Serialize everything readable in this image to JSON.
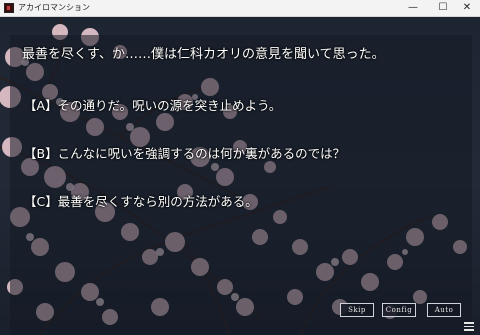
{
  "window": {
    "title": "アカイロマンション",
    "minimize_glyph": "—",
    "maximize_glyph": "☐",
    "close_glyph": "✕"
  },
  "dialogue": {
    "narration": "最善を尽くす、か……僕は仁科カオリの意見を聞いて思った。"
  },
  "choices": [
    {
      "label": "【A】その通りだ。呪いの源を突き止めよう。"
    },
    {
      "label": "【B】こんなに呪いを強調するのは何か裏があるのでは？"
    },
    {
      "label": "【C】最善を尽くすなら別の方法がある。"
    }
  ],
  "system_buttons": {
    "skip": "Skip",
    "config": "Config",
    "auto": "Auto"
  },
  "icons": {
    "menu": "hamburger-menu-icon",
    "app": "app-icon"
  },
  "colors": {
    "text": "#ffffff",
    "blossom": "#e8c7cf",
    "sky": "#1e2532"
  }
}
